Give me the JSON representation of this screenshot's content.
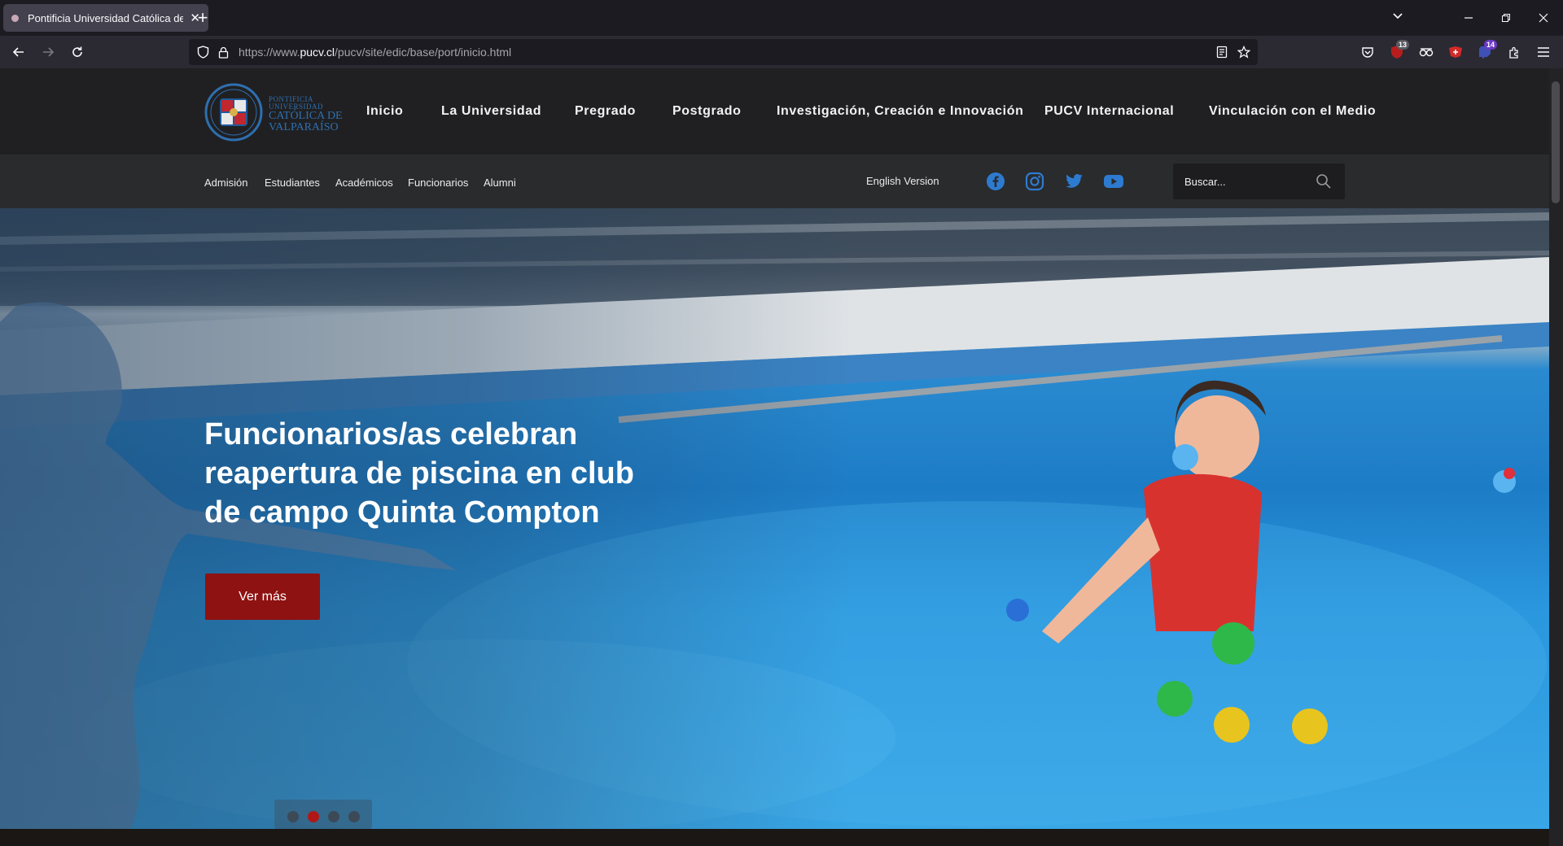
{
  "browser": {
    "tab_title": "Pontificia Universidad Católica de Valparaíso",
    "url_prefix": "https://www.",
    "url_domain": "pucv.cl",
    "url_path": "/pucv/site/edic/base/port/inicio.html",
    "badges": {
      "ext1": "13",
      "ext2": "14"
    }
  },
  "header": {
    "logo": {
      "line1": "PONTIFICIA",
      "line2": "UNIVERSIDAD",
      "line3": "CATÓLICA DE",
      "line4": "VALPARAÍSO"
    },
    "main_nav": [
      "Inicio",
      "La Universidad",
      "Pregrado",
      "Postgrado",
      "Investigación, Creación e Innovación",
      "PUCV Internacional",
      "Vinculación con el Medio"
    ],
    "sub_nav": [
      "Admisión",
      "Estudiantes",
      "Académicos",
      "Funcionarios",
      "Alumni"
    ],
    "english_link": "English Version",
    "search_placeholder": "Buscar..."
  },
  "hero": {
    "title": "Funcionarios/as celebran reapertura de piscina en club de campo Quinta Compton",
    "button": "Ver más",
    "slides_total": 4,
    "active_slide": 2
  },
  "colors": {
    "accent": "#8e1212",
    "header_bg": "#202022",
    "subheader_bg": "#2a2b2d",
    "social_blue": "#2d7bd0"
  }
}
